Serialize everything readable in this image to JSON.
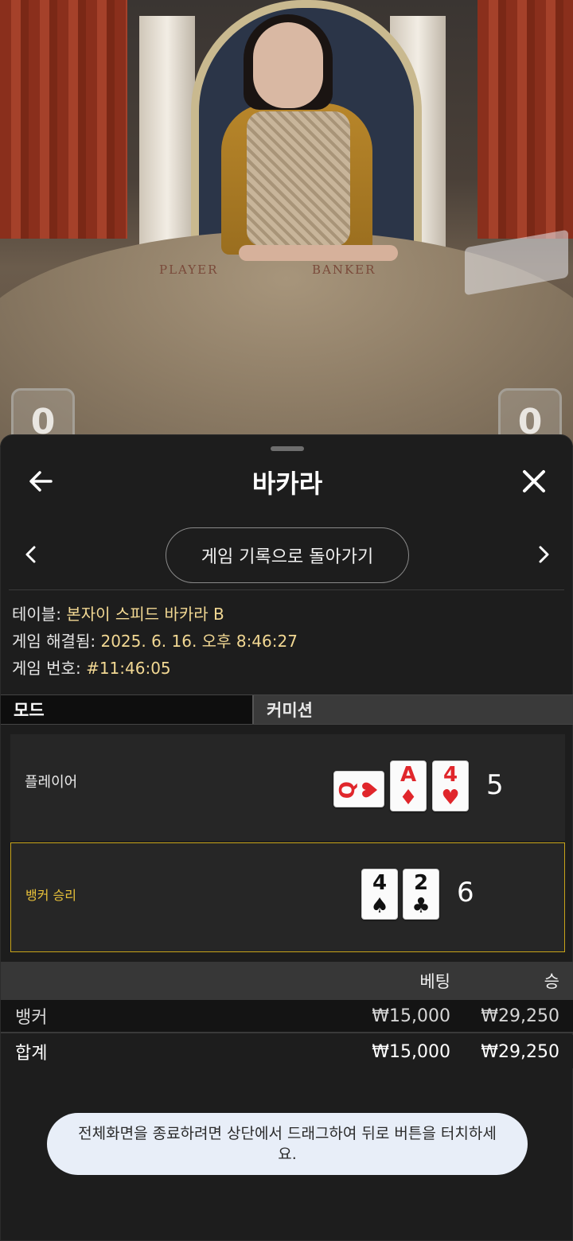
{
  "video": {
    "felt_player": "PLAYER",
    "felt_banker": "BANKER",
    "player_score_badge": "0",
    "banker_score_badge": "0"
  },
  "sheet": {
    "title": "바카라",
    "back_icon": "arrow-left-icon",
    "close_icon": "close-x-icon",
    "history_button": "게임 기록으로 돌아가기",
    "prev_icon": "chevron-left-icon",
    "next_icon": "chevron-right-icon"
  },
  "info": {
    "table_label": "테이블:",
    "table_value": "본자이 스피드 바카라 B",
    "resolved_label": "게임 해결됨:",
    "resolved_value": "2025. 6. 16. 오후 8:46:27",
    "game_no_label": "게임 번호:",
    "game_no_value": "#11:46:05"
  },
  "tabs": {
    "mode": "모드",
    "commission": "커미션"
  },
  "player_hand": {
    "label": "플레이어",
    "score": "5",
    "cards": [
      {
        "rank": "Q",
        "suit": "♥",
        "color": "red",
        "orientation": "sideways"
      },
      {
        "rank": "A",
        "suit": "♦",
        "color": "red"
      },
      {
        "rank": "4",
        "suit": "♥",
        "color": "red"
      }
    ]
  },
  "banker_hand": {
    "label": "뱅커 승리",
    "score": "6",
    "cards": [
      {
        "rank": "4",
        "suit": "♠",
        "color": "black"
      },
      {
        "rank": "2",
        "suit": "♣",
        "color": "black"
      }
    ]
  },
  "bets": {
    "col_bet": "베팅",
    "col_win": "승",
    "rows": [
      {
        "name": "뱅커",
        "bet": "₩15,000",
        "win": "₩29,250"
      },
      {
        "name": "합계",
        "bet": "₩15,000",
        "win": "₩29,250"
      }
    ]
  },
  "toast": {
    "text": "전체화면을 종료하려면 상단에서 드래그하여 뒤로 버튼을 터치하세요."
  },
  "colors": {
    "accent_gold": "#c8a419",
    "info_value": "#f2d893",
    "sheet_bg": "#1d1d1d",
    "card_red": "#e0262b"
  }
}
